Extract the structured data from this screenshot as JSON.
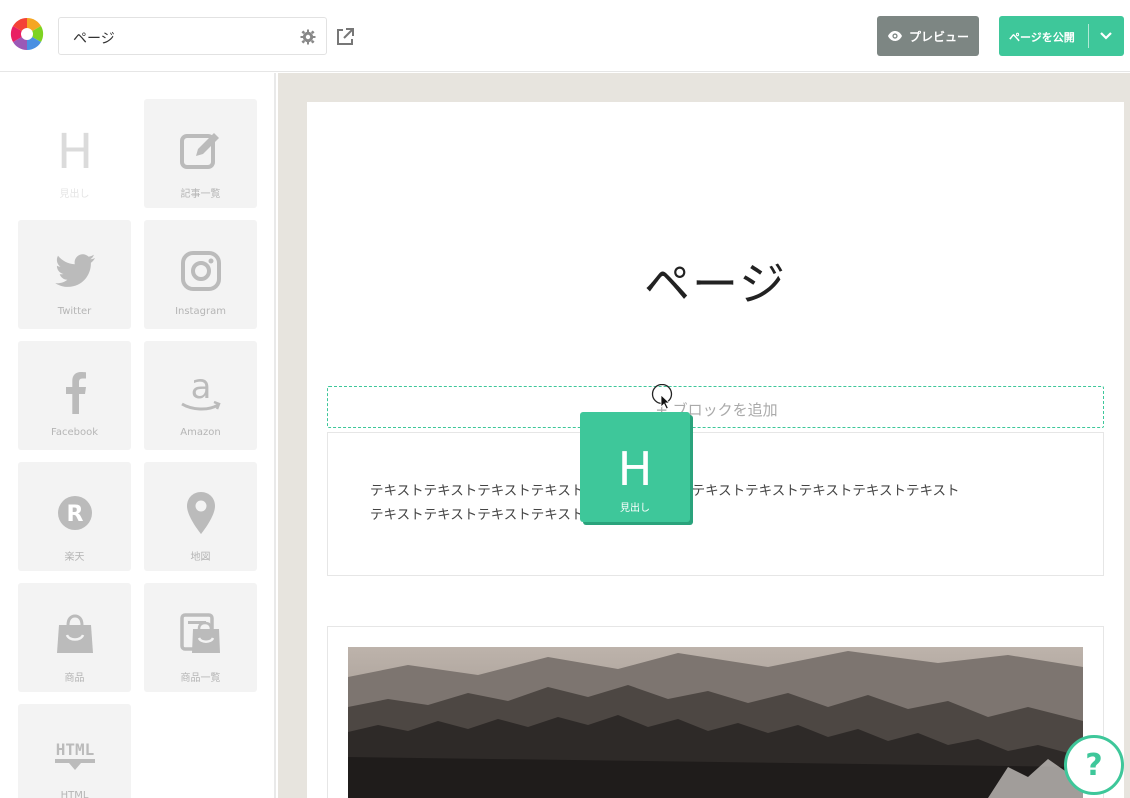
{
  "header": {
    "page_title_value": "ページ",
    "preview_label": "プレビュー",
    "publish_label": "ページを公開"
  },
  "sidebar": {
    "tiles": [
      {
        "label": "見出し",
        "icon": "heading-icon"
      },
      {
        "label": "記事一覧",
        "icon": "edit-icon"
      },
      {
        "label": "Twitter",
        "icon": "twitter-icon"
      },
      {
        "label": "Instagram",
        "icon": "instagram-icon"
      },
      {
        "label": "Facebook",
        "icon": "facebook-icon"
      },
      {
        "label": "Amazon",
        "icon": "amazon-icon"
      },
      {
        "label": "楽天",
        "icon": "rakuten-icon"
      },
      {
        "label": "地図",
        "icon": "map-pin-icon"
      },
      {
        "label": "商品",
        "icon": "shopping-bag-icon"
      },
      {
        "label": "商品一覧",
        "icon": "product-list-icon"
      },
      {
        "label": "HTML",
        "icon": "html-icon"
      }
    ]
  },
  "canvas": {
    "page_heading": "ページ",
    "add_block_label": "+ ブロックを追加",
    "text_lines": [
      "テキストテキストテキストテキストテキストテキストテキストテキストテキストテキストテキスト",
      "テキストテキストテキストテキストテキストテキスト"
    ]
  },
  "drag_ghost": {
    "glyph": "H",
    "label": "見出し"
  },
  "help": {
    "glyph": "?"
  },
  "colors": {
    "accent": "#3ec79a",
    "preview_button": "#7d8683",
    "canvas_background": "#e7e4de"
  }
}
